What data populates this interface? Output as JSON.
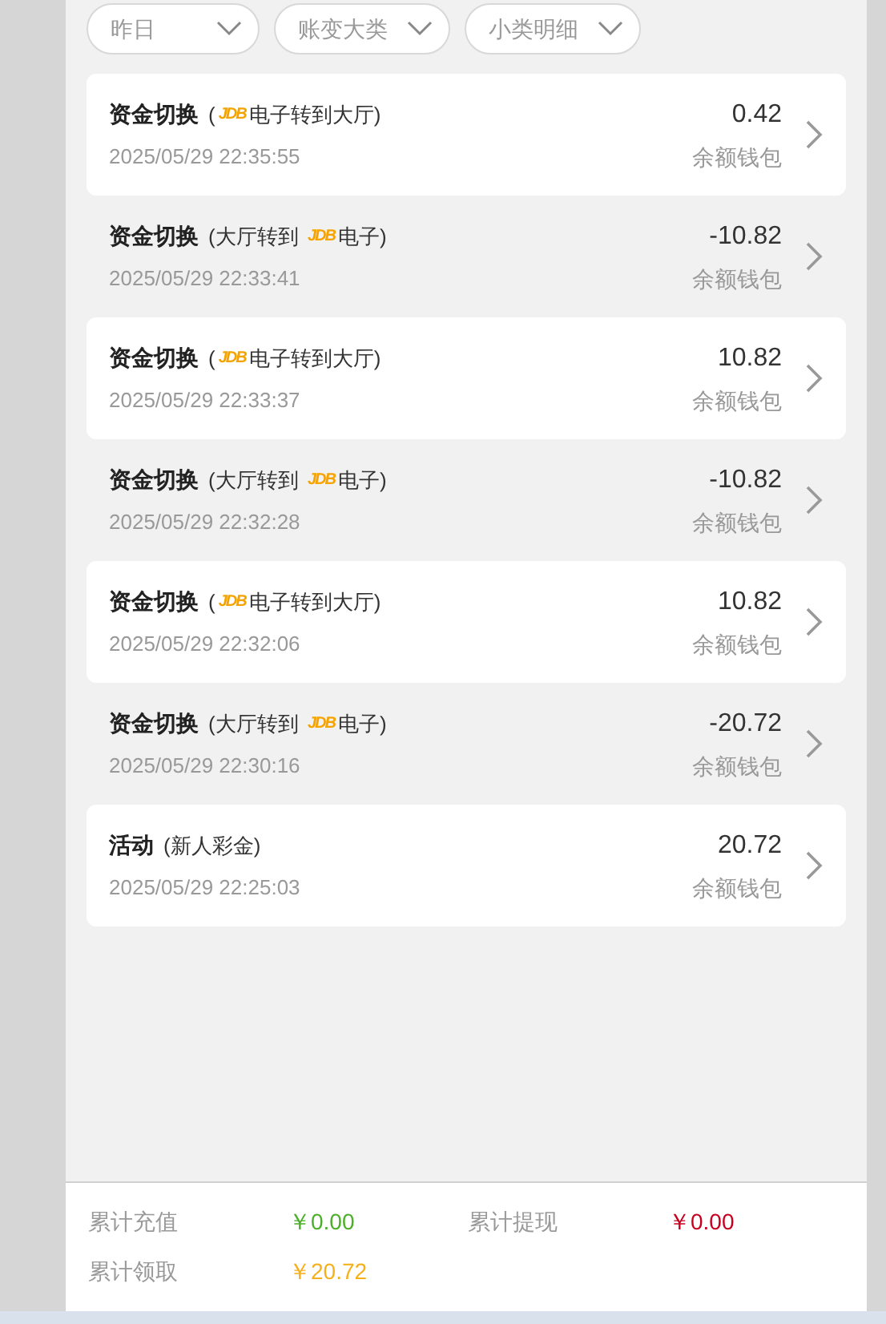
{
  "filters": [
    {
      "label": "昨日"
    },
    {
      "label": "账变大类"
    },
    {
      "label": "小类明细"
    }
  ],
  "records": [
    {
      "title": "资金切换",
      "note": [
        {
          "kind": "text",
          "text": "("
        },
        {
          "kind": "logo",
          "text": "JDB"
        },
        {
          "kind": "text",
          "text": "电子转到大厅)"
        }
      ],
      "time": "2025/05/29 22:35:55",
      "amount": "0.42",
      "wallet": "余额钱包"
    },
    {
      "title": "资金切换",
      "note": [
        {
          "kind": "text",
          "text": "(大厅转到 "
        },
        {
          "kind": "logo",
          "text": "JDB"
        },
        {
          "kind": "text",
          "text": "电子)"
        }
      ],
      "time": "2025/05/29 22:33:41",
      "amount": "-10.82",
      "wallet": "余额钱包"
    },
    {
      "title": "资金切换",
      "note": [
        {
          "kind": "text",
          "text": "("
        },
        {
          "kind": "logo",
          "text": "JDB"
        },
        {
          "kind": "text",
          "text": "电子转到大厅)"
        }
      ],
      "time": "2025/05/29 22:33:37",
      "amount": "10.82",
      "wallet": "余额钱包"
    },
    {
      "title": "资金切换",
      "note": [
        {
          "kind": "text",
          "text": "(大厅转到 "
        },
        {
          "kind": "logo",
          "text": "JDB"
        },
        {
          "kind": "text",
          "text": "电子)"
        }
      ],
      "time": "2025/05/29 22:32:28",
      "amount": "-10.82",
      "wallet": "余额钱包"
    },
    {
      "title": "资金切换",
      "note": [
        {
          "kind": "text",
          "text": "("
        },
        {
          "kind": "logo",
          "text": "JDB"
        },
        {
          "kind": "text",
          "text": "电子转到大厅)"
        }
      ],
      "time": "2025/05/29 22:32:06",
      "amount": "10.82",
      "wallet": "余额钱包"
    },
    {
      "title": "资金切换",
      "note": [
        {
          "kind": "text",
          "text": "(大厅转到 "
        },
        {
          "kind": "logo",
          "text": "JDB"
        },
        {
          "kind": "text",
          "text": "电子)"
        }
      ],
      "time": "2025/05/29 22:30:16",
      "amount": "-20.72",
      "wallet": "余额钱包"
    },
    {
      "title": "活动",
      "note": [
        {
          "kind": "text",
          "text": "(新人彩金)"
        }
      ],
      "time": "2025/05/29 22:25:03",
      "amount": "20.72",
      "wallet": "余额钱包"
    }
  ],
  "summary": [
    {
      "label": "累计充值",
      "value": "￥0.00",
      "color": "#4caf2a"
    },
    {
      "label": "累计提现",
      "value": "￥0.00",
      "color": "#c8001e"
    },
    {
      "label": "累计领取",
      "value": "￥20.72",
      "color": "#f5b01c"
    }
  ]
}
